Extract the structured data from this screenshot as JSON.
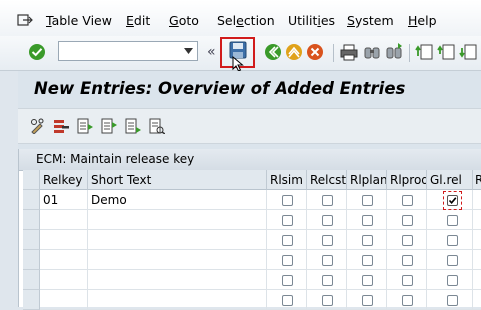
{
  "menu": {
    "items": [
      {
        "mnemonic": "T",
        "rest": "able View"
      },
      {
        "mnemonic": "E",
        "rest": "dit"
      },
      {
        "mnemonic": "G",
        "rest": "oto"
      },
      {
        "pre": "Sel",
        "mnemonic": "e",
        "rest": "ction"
      },
      {
        "pre": "Utilit",
        "mnemonic": "i",
        "rest": "es"
      },
      {
        "mnemonic": "S",
        "rest": "ystem"
      },
      {
        "mnemonic": "H",
        "rest": "elp"
      }
    ]
  },
  "toolbar": {
    "command_value": "",
    "expand_glyph": "«"
  },
  "page": {
    "title": "New Entries: Overview of Added Entries"
  },
  "table": {
    "title": "ECM: Maintain release key",
    "columns": [
      "Relkey",
      "Short Text",
      "Rlsim",
      "Relcst",
      "Rlplan",
      "Rlprod",
      "Gl.rel",
      "R"
    ],
    "rows": [
      {
        "relkey": "01",
        "short_text": "Demo",
        "rlsim": false,
        "relcst": false,
        "rlplan": false,
        "rlprod": false,
        "glrel": true
      },
      {
        "relkey": "",
        "short_text": "",
        "rlsim": false,
        "relcst": false,
        "rlplan": false,
        "rlprod": false,
        "glrel": false
      },
      {
        "relkey": "",
        "short_text": "",
        "rlsim": false,
        "relcst": false,
        "rlplan": false,
        "rlprod": false,
        "glrel": false
      },
      {
        "relkey": "",
        "short_text": "",
        "rlsim": false,
        "relcst": false,
        "rlplan": false,
        "rlprod": false,
        "glrel": false
      },
      {
        "relkey": "",
        "short_text": "",
        "rlsim": false,
        "relcst": false,
        "rlplan": false,
        "rlprod": false,
        "glrel": false
      },
      {
        "relkey": "",
        "short_text": "",
        "rlsim": false,
        "relcst": false,
        "rlplan": false,
        "rlprod": false,
        "glrel": false
      }
    ]
  },
  "colors": {
    "highlight": "#d11b1b",
    "accent_green": "#3a9a2a",
    "accent_orange": "#e07a1a"
  }
}
